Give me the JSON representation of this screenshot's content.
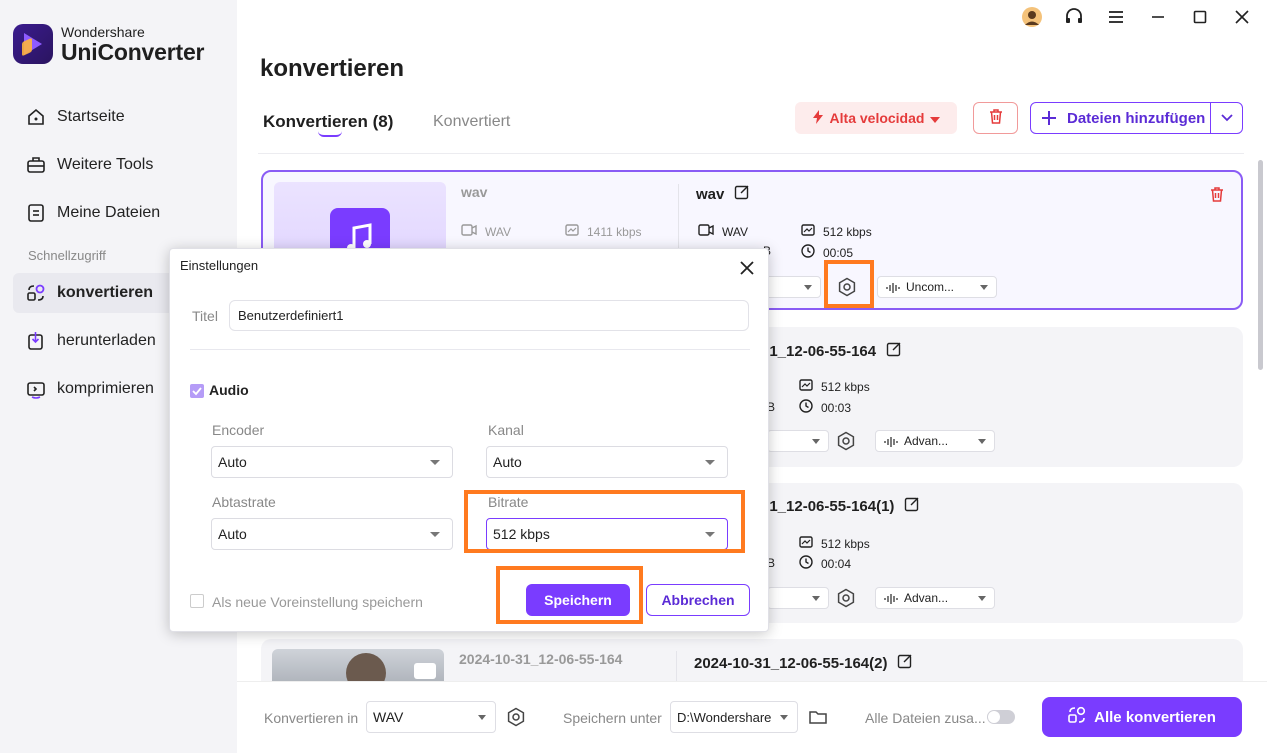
{
  "app": {
    "brand": "Wondershare",
    "product": "UniConverter"
  },
  "sidebar": {
    "items": [
      {
        "label": "Startseite",
        "icon": "home-icon"
      },
      {
        "label": "Weitere Tools",
        "icon": "toolbox-icon"
      },
      {
        "label": "Meine Dateien",
        "icon": "files-icon"
      },
      {
        "label": "konvertieren",
        "icon": "convert-icon",
        "active": true
      },
      {
        "label": "herunterladen",
        "icon": "download-icon"
      },
      {
        "label": "komprimieren",
        "icon": "compress-icon"
      }
    ],
    "section": "Schnellzugriff"
  },
  "page": {
    "title": "konvertieren"
  },
  "tabs": {
    "active": "Konvertieren (8)",
    "inactive": "Konvertiert"
  },
  "toolbar": {
    "speed_label": "Alta velocidad",
    "add_label": "Dateien hinzufügen"
  },
  "cards": [
    {
      "src_name": "wav",
      "src_format": "WAV",
      "src_bitrate": "1411 kbps",
      "dst_name": "wav",
      "dst_format": "WAV",
      "dst_size": "B",
      "dst_bitrate": "512 kbps",
      "dst_duration": "00:05",
      "audio_option": "Uncom..."
    },
    {
      "dst_name": "31_12-06-55-164",
      "dst_size": "B",
      "dst_bitrate": "512 kbps",
      "dst_duration": "00:03",
      "audio_option": "Advan..."
    },
    {
      "dst_name": "31_12-06-55-164(1)",
      "dst_size": "B",
      "dst_bitrate": "512 kbps",
      "dst_duration": "00:04",
      "audio_option": "Advan..."
    },
    {
      "src_name": "2024-10-31_12-06-55-164",
      "dst_name": "2024-10-31_12-06-55-164(2)"
    }
  ],
  "bottombar": {
    "convert_in_label": "Konvertieren in",
    "convert_in_value": "WAV",
    "save_to_label": "Speichern unter",
    "save_to_value": "D:\\Wondershare",
    "merge_label": "Alle Dateien zusa...",
    "convert_all_label": "Alle konvertieren"
  },
  "dialog": {
    "title": "Einstellungen",
    "title_label": "Titel",
    "title_value": "Benutzerdefiniert1",
    "audio_label": "Audio",
    "encoder_label": "Encoder",
    "encoder_value": "Auto",
    "channel_label": "Kanal",
    "channel_value": "Auto",
    "samplerate_label": "Abtastrate",
    "samplerate_value": "Auto",
    "bitrate_label": "Bitrate",
    "bitrate_value": "512 kbps",
    "save_preset_label": "Als neue Voreinstellung speichern",
    "save_button": "Speichern",
    "cancel_button": "Abbrechen"
  },
  "colors": {
    "accent": "#7a3cff",
    "highlight": "#ff7a1f",
    "danger": "#e53b3b"
  }
}
